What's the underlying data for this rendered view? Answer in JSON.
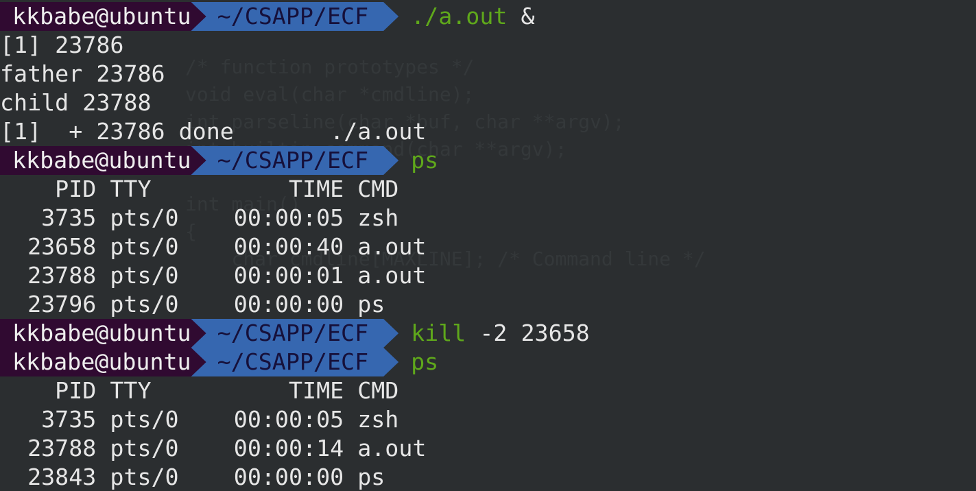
{
  "prompt": {
    "user": "kkbabe@ubuntu",
    "path": "~/CSAPP/ECF"
  },
  "commands": [
    {
      "prog": "./a.out",
      "args": " &"
    },
    {
      "prog": "ps",
      "args": ""
    },
    {
      "prog": "kill",
      "args": " -2 23658"
    },
    {
      "prog": "ps",
      "args": ""
    }
  ],
  "output1": [
    "[1] 23786",
    "father 23786",
    "child 23788",
    "[1]  + 23786 done       ./a.out"
  ],
  "ps1": {
    "header": "    PID TTY          TIME CMD",
    "rows": [
      "   3735 pts/0    00:00:05 zsh",
      "  23658 pts/0    00:00:40 a.out",
      "  23788 pts/0    00:00:01 a.out",
      "  23796 pts/0    00:00:00 ps"
    ]
  },
  "ps2": {
    "header": "    PID TTY          TIME CMD",
    "rows": [
      "   3735 pts/0    00:00:05 zsh",
      "  23788 pts/0    00:00:14 a.out",
      "  23843 pts/0    00:00:00 ps"
    ]
  },
  "colors": {
    "background": "#2b2e30",
    "user_segment": "#300a31",
    "path_segment": "#3667b0",
    "command": "#5fa81b"
  }
}
